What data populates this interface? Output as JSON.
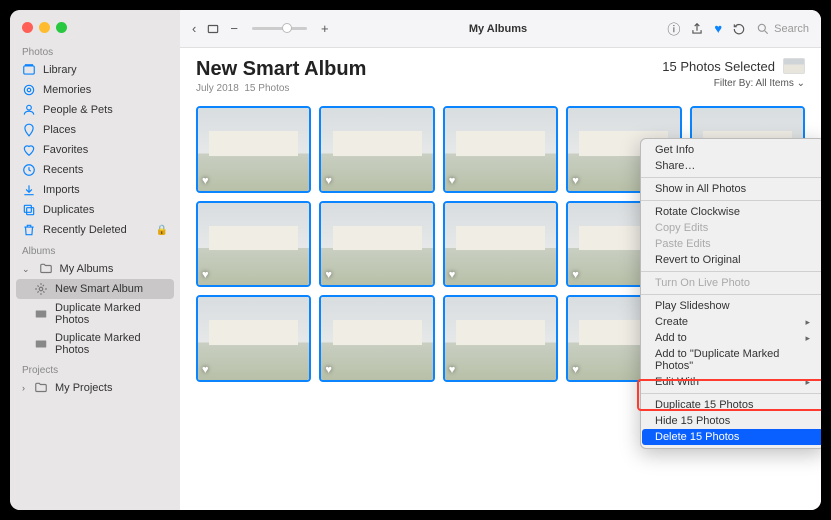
{
  "toolbar": {
    "title_center": "My Albums",
    "search_placeholder": "Search"
  },
  "sidebar": {
    "sections": {
      "photos": "Photos",
      "albums": "Albums",
      "projects": "Projects"
    },
    "items": {
      "library": "Library",
      "memories": "Memories",
      "people": "People & Pets",
      "places": "Places",
      "favorites": "Favorites",
      "recents": "Recents",
      "imports": "Imports",
      "duplicates": "Duplicates",
      "recently_deleted": "Recently Deleted",
      "my_albums": "My Albums",
      "new_smart": "New Smart Album",
      "dup_marked": "Duplicate Marked Photos",
      "dup_marked2": "Duplicate Marked Photos",
      "my_projects": "My Projects"
    }
  },
  "header": {
    "title": "New Smart Album",
    "date": "July 2018",
    "count": "15 Photos",
    "selected": "15 Photos Selected",
    "filter_label": "Filter By:",
    "filter_value": "All Items"
  },
  "context_menu": {
    "get_info": "Get Info",
    "share": "Share…",
    "show_all": "Show in All Photos",
    "rotate": "Rotate Clockwise",
    "copy_edits": "Copy Edits",
    "paste_edits": "Paste Edits",
    "revert": "Revert to Original",
    "live_photo": "Turn On Live Photo",
    "slideshow": "Play Slideshow",
    "create": "Create",
    "add_to": "Add to",
    "add_to_album": "Add to \"Duplicate Marked Photos\"",
    "edit_with": "Edit With",
    "duplicate": "Duplicate 15 Photos",
    "hide": "Hide 15 Photos",
    "delete": "Delete 15 Photos"
  }
}
